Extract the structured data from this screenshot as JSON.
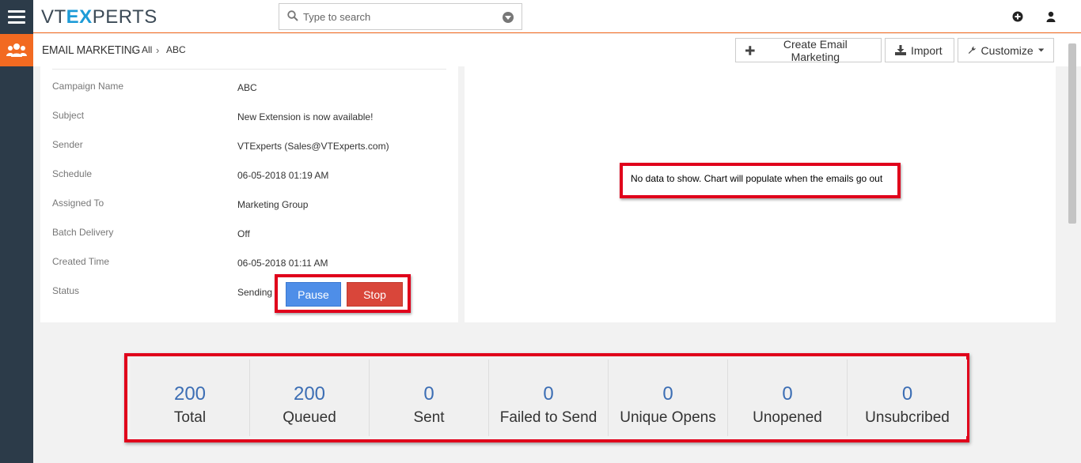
{
  "app": {
    "logo_part1": "VT",
    "logo_part2": "EX",
    "logo_part3": "PERTS"
  },
  "search": {
    "placeholder": "Type to search"
  },
  "breadcrumb": {
    "module": "EMAIL MARKETING",
    "filter": "All",
    "record": "ABC"
  },
  "toolbar": {
    "create_label": "Create Email Marketing",
    "import_label": "Import",
    "customize_label": "Customize"
  },
  "fields": [
    {
      "label": "Campaign Name",
      "value": "ABC"
    },
    {
      "label": "Subject",
      "value": "New Extension is now available!"
    },
    {
      "label": "Sender",
      "value": "VTExperts (Sales@VTExperts.com)"
    },
    {
      "label": "Schedule",
      "value": "06-05-2018 01:19 AM"
    },
    {
      "label": "Assigned To",
      "value": "Marketing Group"
    },
    {
      "label": "Batch Delivery",
      "value": "Off"
    },
    {
      "label": "Created Time",
      "value": "06-05-2018 01:11 AM"
    },
    {
      "label": "Status",
      "value": "Sending"
    }
  ],
  "actions": {
    "pause_label": "Pause",
    "stop_label": "Stop"
  },
  "chart": {
    "message": "No data to show. Chart will populate when the emails go out"
  },
  "stats": [
    {
      "value": "200",
      "label": "Total"
    },
    {
      "value": "200",
      "label": "Queued"
    },
    {
      "value": "0",
      "label": "Sent"
    },
    {
      "value": "0",
      "label": "Failed to Send"
    },
    {
      "value": "0",
      "label": "Unique Opens"
    },
    {
      "value": "0",
      "label": "Unopened"
    },
    {
      "value": "0",
      "label": "Unsubcribed"
    }
  ],
  "colors": {
    "accent": "#f26a21",
    "rail": "#2c3b49",
    "highlight": "#e0001b",
    "stat_number": "#3c6eb4",
    "pause": "#4e8ee8",
    "stop": "#d9463a"
  }
}
